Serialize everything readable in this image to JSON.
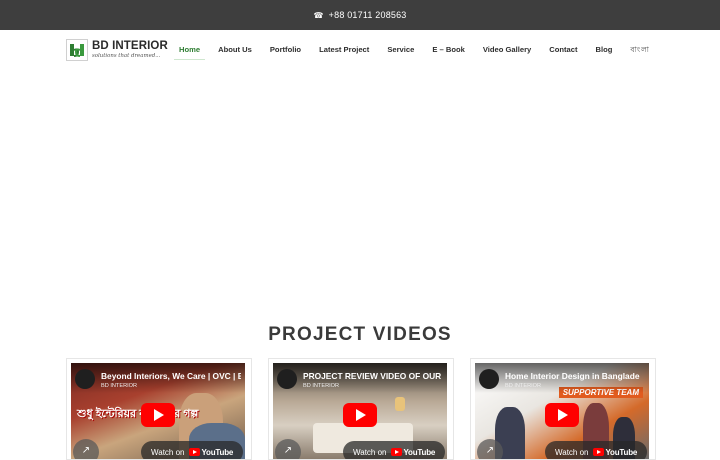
{
  "topbar": {
    "phone_icon": "phone-icon",
    "phone": "+88 01711 208563"
  },
  "logo": {
    "name": "BD INTERIOR",
    "tagline": "solutions that dreamed...",
    "mark_icon": "bd-logo-mark"
  },
  "nav": {
    "items": [
      {
        "label": "Home",
        "active": true
      },
      {
        "label": "About Us"
      },
      {
        "label": "Portfolio"
      },
      {
        "label": "Latest Project"
      },
      {
        "label": "Service"
      },
      {
        "label": "E – Book"
      },
      {
        "label": "Video Gallery"
      },
      {
        "label": "Contact"
      },
      {
        "label": "Blog"
      }
    ],
    "language": "বাংলা"
  },
  "section": {
    "title": "PROJECT VIDEOS"
  },
  "videos": [
    {
      "title": "Beyond Interiors, We Care | OVC | B",
      "channel": "BD INTERIOR",
      "overlay": "শুধু ইন্টেরিয়র নয় যত্নের গল্প",
      "watch": "Watch on",
      "yt": "YouTube"
    },
    {
      "title": "PROJECT REVIEW VIDEO OF OUR",
      "channel": "BD INTERIOR",
      "overlay": "",
      "watch": "Watch on",
      "yt": "YouTube"
    },
    {
      "title": "Home Interior Design in Banglade",
      "channel": "BD INTERIOR",
      "overlay": "SUPPORTIVE TEAM",
      "watch": "Watch on",
      "yt": "YouTube"
    }
  ],
  "colors": {
    "topbar": "#3e3e3e",
    "active_nav": "#2e7d32",
    "play_button": "#ff0000"
  }
}
